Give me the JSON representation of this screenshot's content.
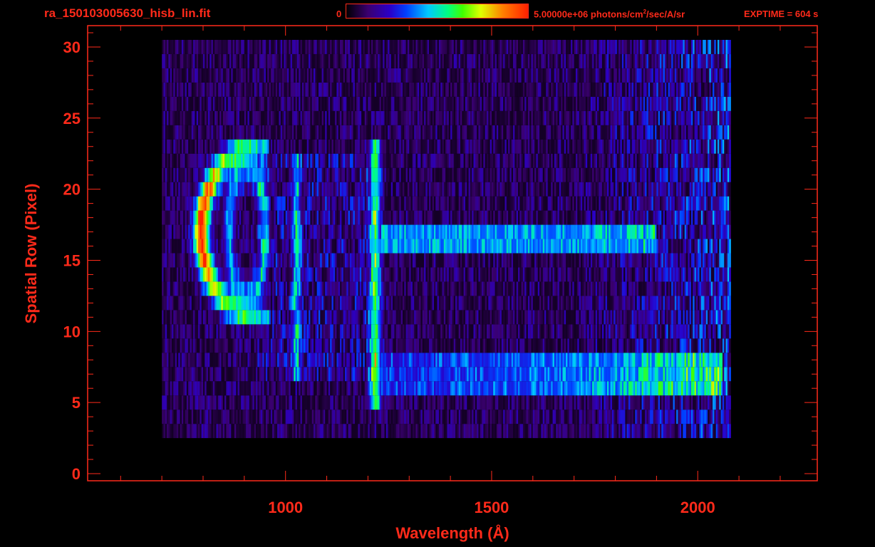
{
  "header": {
    "filename": "ra_150103005630_hisb_lin.fit",
    "colorbar_min": "0",
    "colorbar_max": "5.00000e+06 photons/cm",
    "colorbar_max_exp": "2",
    "colorbar_max_unit": "/sec/A/sr",
    "exptime": "EXPTIME = 604 s"
  },
  "chart_data": {
    "type": "heatmap",
    "title": "ra_150103005630_hisb_lin.fit",
    "xlabel": "Wavelength (Å)",
    "ylabel": "Spatial Row (Pixel)",
    "xlim": [
      520,
      2290
    ],
    "ylim": [
      -0.5,
      31.5
    ],
    "x_ticks": [
      "1000",
      "1500",
      "2000"
    ],
    "x_tick_values": [
      1000,
      1500,
      2000
    ],
    "y_ticks": [
      "0",
      "5",
      "10",
      "15",
      "20",
      "25",
      "30"
    ],
    "y_tick_values": [
      0,
      5,
      10,
      15,
      20,
      25,
      30
    ],
    "colorbar": {
      "min": 0,
      "max": 5000000,
      "units": "photons/cm^2/sec/A/sr"
    },
    "colors": {
      "axis": "#ff2a1a",
      "background": "#000000"
    },
    "data_extent": {
      "wavelength": [
        700,
        2080
      ],
      "rows": [
        3,
        30
      ]
    },
    "features": [
      {
        "label": "bright arc",
        "wavelength": [
          790,
          930
        ],
        "rows": [
          11,
          23
        ],
        "relative_peak": 0.85
      },
      {
        "label": "inner loop",
        "wavelength": [
          850,
          940
        ],
        "rows": [
          12,
          22
        ],
        "relative_peak": 0.4
      },
      {
        "label": "line",
        "wavelength": 1025,
        "rows": [
          7,
          22
        ],
        "relative_peak": 0.38
      },
      {
        "label": "line",
        "wavelength": 1216,
        "rows": [
          5,
          23
        ],
        "relative_peak": 0.6
      },
      {
        "label": "band",
        "wavelength": [
          1230,
          1900
        ],
        "rows": [
          16,
          17
        ],
        "relative_peak": 0.4
      },
      {
        "label": "band",
        "wavelength": [
          1230,
          2060
        ],
        "rows": [
          6,
          8
        ],
        "relative_peak": 0.3
      }
    ],
    "grid": false
  }
}
